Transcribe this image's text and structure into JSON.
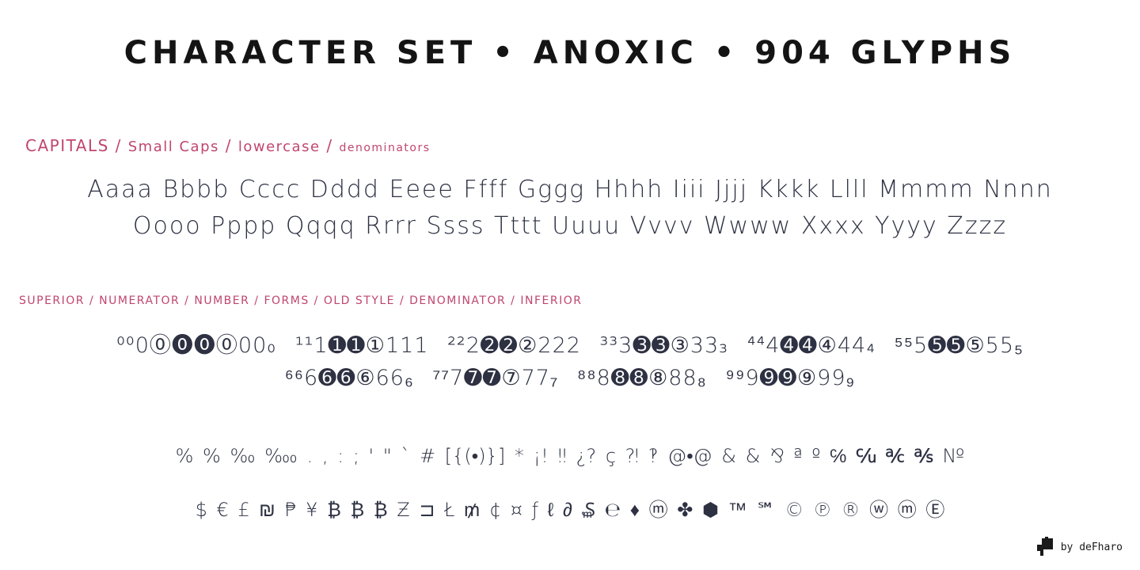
{
  "title": "CHARACTER SET • ANOXIC • 904 GLYPHS",
  "letters_label": {
    "capitals": "CAPITALS",
    "sep1": " / ",
    "small_caps": "Small Caps",
    "sep2": " / ",
    "lowercase": "lowercase",
    "sep3": " / ",
    "denominators": "denominators"
  },
  "letters_line1": "Aaaa Bbbb Cccc Dddd Eeee Ffff Gggg Hhhh Iiii Jjjj Kkkk Llll Mmmm Nnnn",
  "letters_line2": "Oooo Pppp Qqqq Rrrr Ssss Tttt Uuuu Vvvv Wwww Xxxx Yyyy Zzzz",
  "numbers_label": "SUPERIOR / NUMERATOR / NUMBER / FORMS / OLD STYLE / DENOMINATOR / INFERIOR",
  "numbers_line1": [
    "⁰⁰0⓪⓿🄌⓪00₀",
    "¹¹1➊➊①111",
    "²²2➋➋②222",
    "³³3➌➌③33₃",
    "⁴⁴4➍➍④44₄",
    "⁵⁵5➎➎⑤55₅"
  ],
  "numbers_line2": [
    "⁶⁶6➏➏⑥66₆",
    "⁷⁷7➐➐⑦77₇",
    "⁸⁸8➑➑⑧88₈",
    "⁹⁹9➒➒⑨99₉"
  ],
  "symbols_line1": "% % ‰ ‱ . , : ; ' \" ` # [{(•)}] * ¡! ‼ ¿? ç ⁈ ‽ @•@ & & ⅋ ª º ℅ ℆ ℀ ℁ №",
  "symbols_line2": "$ € £ ₪ ₱ ¥ ₿ ₿ ₿ Ƶ ⊐ Ł ₥ ¢ ¤ ƒ ℓ ∂ ₷ ℮ ♦ ⓜ ✤ ⬢ ™ ℠ © ℗ ® ⓦ ⓜ Ⓔ",
  "credit": "by deFharo"
}
